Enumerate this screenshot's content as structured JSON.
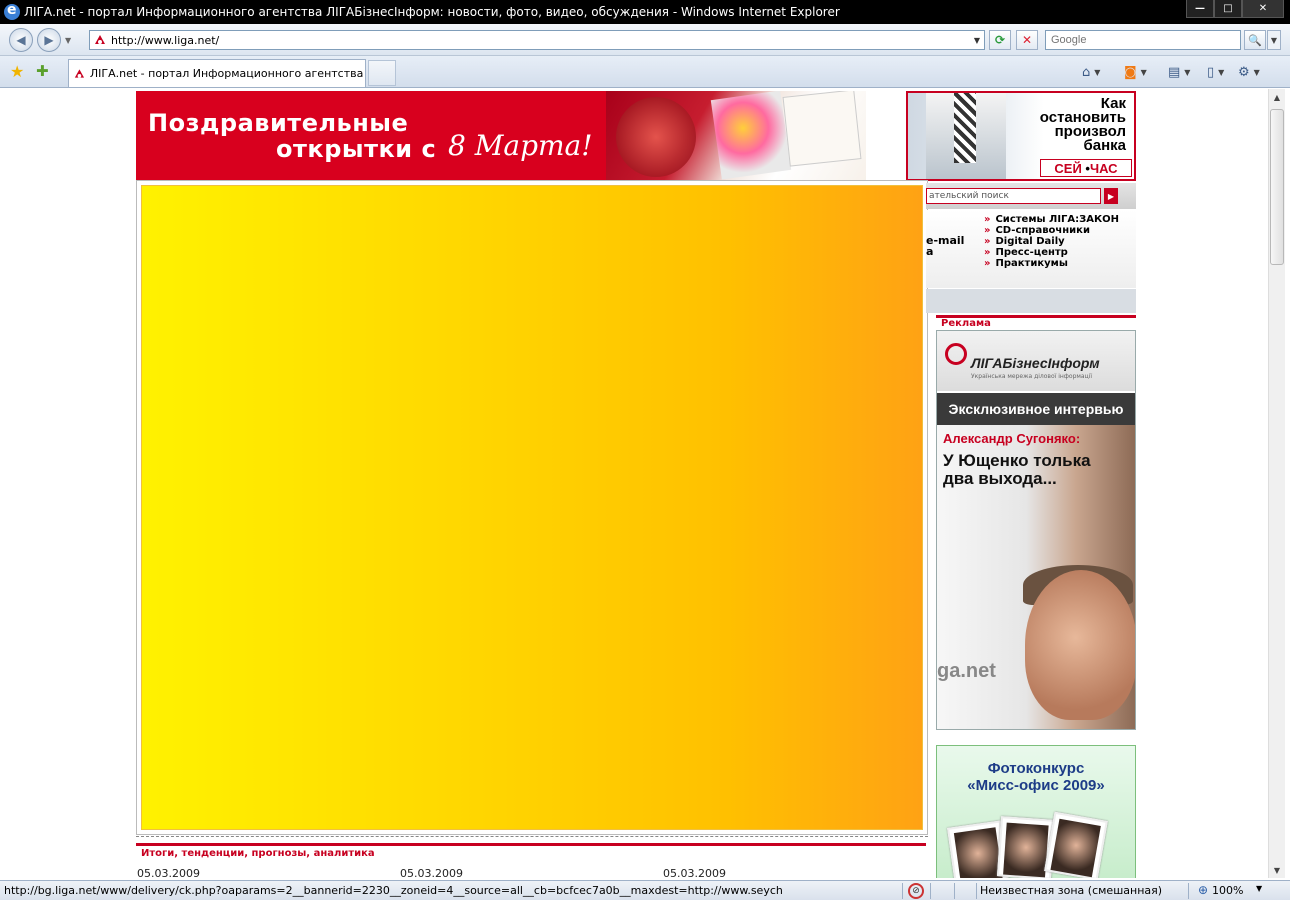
{
  "window": {
    "title": "ЛІГА.net - портал Информационного агентства ЛІГАБізнесІнформ: новости, фото, видео, обсуждения - Windows Internet Explorer",
    "controls": {
      "minimize": "—",
      "maximize": "□",
      "close": "✕"
    }
  },
  "addressbar": {
    "url": "http://www.liga.net/",
    "search_placeholder": "Google"
  },
  "tabs": [
    {
      "label": "ЛІГА.net - портал Информационного агентства ЛІ..."
    }
  ],
  "banner": {
    "line1": "Поздравительные",
    "line2": "открытки с",
    "script": "8 Марта!"
  },
  "ad_right": {
    "text": "Как остановить произвол банка",
    "logo_a": "СЕЙ",
    "logo_b": "ЧАС"
  },
  "right_column": {
    "search_placeholder": "ательский поиск",
    "left_items": [
      "e-mail",
      "a"
    ],
    "links": [
      "Системы ЛІГА:ЗАКОН",
      "CD-справочники",
      "Digital Daily",
      "Пресс-центр",
      "Практикумы"
    ],
    "ad_label": "Реклама"
  },
  "promo": {
    "logo": "ЛІГАБізнесІнформ",
    "logo_sub": "Українська мережа ділової інформації",
    "headline": "Эксклюзивное интервью",
    "name": "Александр Сугоняко:",
    "quote": "У Ющенко толька два выхода...",
    "watermark": "ga.net"
  },
  "photo_contest": {
    "title_line1": "Фотоконкурс",
    "title_line2": "«Мисс-офис 2009»"
  },
  "section": {
    "title": "Итоги, тенденции, прогнозы, аналитика",
    "dates": [
      "05.03.2009",
      "05.03.2009",
      "05.03.2009"
    ]
  },
  "statusbar": {
    "status_text": "http://bg.liga.net/www/delivery/ck.php?oaparams=2__bannerid=2230__zoneid=4__source=all__cb=bcfcec7a0b__maxdest=http://www.seych",
    "zone": "Неизвестная зона (смешанная)",
    "zoom": "100%"
  },
  "colors": {
    "brand_red": "#c70020",
    "flash_gradient_start": "#fff200",
    "flash_gradient_end": "#ffa214"
  }
}
